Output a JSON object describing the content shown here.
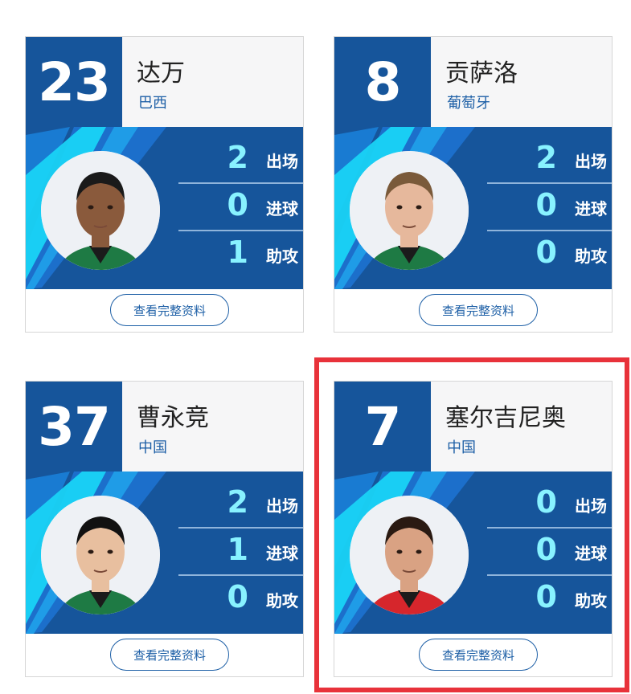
{
  "players": [
    {
      "number": "23",
      "name": "达万",
      "country": "巴西",
      "skin": "#8a5a3c",
      "hair": "#1a1a1a",
      "jersey": "#1e7a44",
      "stats": [
        {
          "value": "2",
          "label": "出场"
        },
        {
          "value": "0",
          "label": "进球"
        },
        {
          "value": "1",
          "label": "助攻"
        }
      ]
    },
    {
      "number": "8",
      "name": "贡萨洛",
      "country": "葡萄牙",
      "skin": "#e6b89c",
      "hair": "#7a5a3a",
      "jersey": "#1e7a44",
      "stats": [
        {
          "value": "2",
          "label": "出场"
        },
        {
          "value": "0",
          "label": "进球"
        },
        {
          "value": "0",
          "label": "助攻"
        }
      ]
    },
    {
      "number": "37",
      "name": "曹永竞",
      "country": "中国",
      "skin": "#e8bf9f",
      "hair": "#111111",
      "jersey": "#1e7a44",
      "stats": [
        {
          "value": "2",
          "label": "出场"
        },
        {
          "value": "1",
          "label": "进球"
        },
        {
          "value": "0",
          "label": "助攻"
        }
      ]
    },
    {
      "number": "7",
      "name": "塞尔吉尼奥",
      "country": "中国",
      "skin": "#d9a283",
      "hair": "#2a1a12",
      "jersey": "#d6262c",
      "stats": [
        {
          "value": "0",
          "label": "出场"
        },
        {
          "value": "0",
          "label": "进球"
        },
        {
          "value": "0",
          "label": "助攻"
        }
      ]
    }
  ],
  "button_label": "查看完整资料",
  "colors": {
    "header_blue": "#16559b",
    "stat_value": "#88f2ff",
    "highlight": "#e8323a",
    "stripe_cyan": "#19d3f5"
  }
}
